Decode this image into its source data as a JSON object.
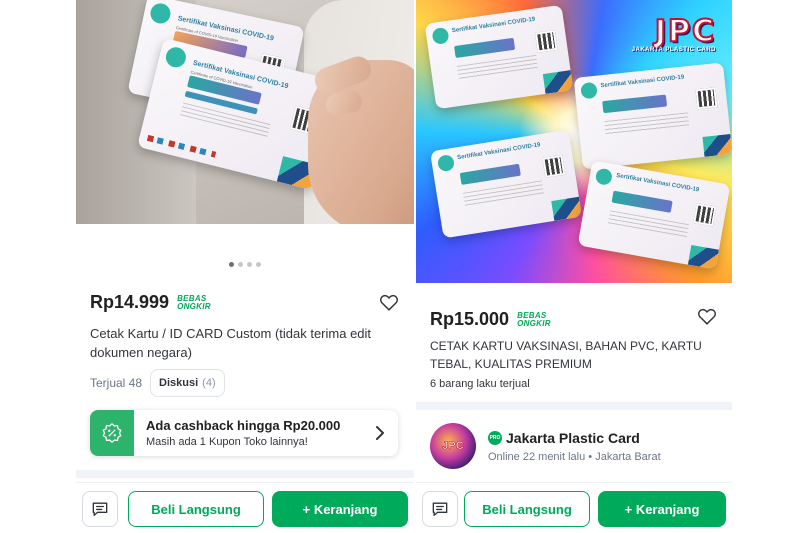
{
  "left": {
    "image": {
      "dots_total": 4,
      "dots_active_index": 0
    },
    "price": "Rp14.999",
    "free_shipping_badge": [
      "BEBAS",
      "ONGKIR"
    ],
    "title": "Cetak Kartu / ID CARD Custom (tidak terima edit dokumen negara)",
    "sold": "Terjual 48",
    "discussion_label": "Diskusi",
    "discussion_count": "(4)",
    "cashback": {
      "title": "Ada cashback hingga Rp20.000",
      "subtitle": "Masih ada 1 Kupon Toko lainnya!"
    },
    "bottom": {
      "buy_now": "Beli Langsung",
      "add_to_cart": "+ Keranjang"
    }
  },
  "right": {
    "image": {
      "logo_text": "JPC",
      "logo_subtext": "JAKARTA PLASTIC CARD"
    },
    "price": "Rp15.000",
    "free_shipping_badge": [
      "BEBAS",
      "ONGKIR"
    ],
    "title": "CETAK KARTU VAKSINASI, BAHAN PVC, KARTU TEBAL, KUALITAS PREMIUM",
    "sold": "6 barang laku terjual",
    "shop": {
      "badge": "PRO",
      "name": "Jakarta Plastic Card",
      "status_prefix": "Online",
      "status_time": "22 menit lalu",
      "location": "• Jakarta Barat"
    },
    "bottom": {
      "buy_now": "Beli Langsung",
      "add_to_cart": "+ Keranjang"
    }
  },
  "card_text": {
    "title": "Sertifikat Vaksinasi COVID-19",
    "subtitle": "Certificate of COVID-19 Vaccination"
  },
  "colors": {
    "brand_green": "#00aa5b",
    "text_dark": "#212121",
    "muted": "#6d7588"
  },
  "icons": [
    "heart-icon",
    "chat-icon",
    "coupon-icon",
    "chevron-right-icon",
    "pro-badge-icon"
  ]
}
